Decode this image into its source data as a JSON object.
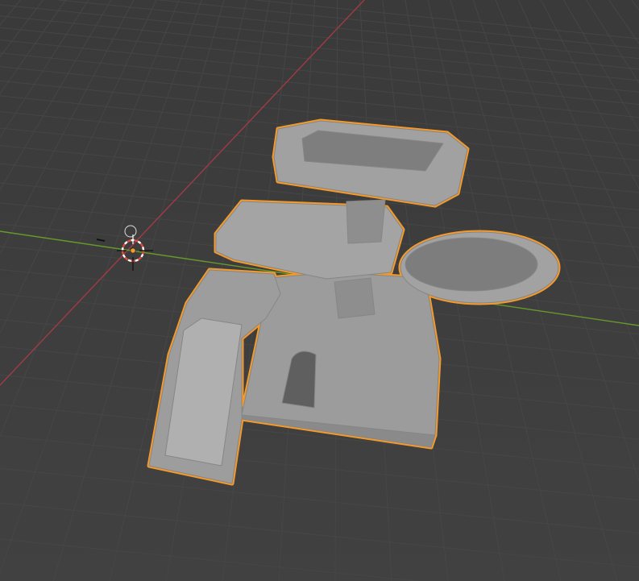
{
  "viewport": {
    "view": "3D Viewport",
    "shading": "solid",
    "background_color": "#3d3d3d",
    "grid_line_color": "#474747",
    "x_axis_color": "#a13a48",
    "y_axis_color": "#66992a"
  },
  "scene_object": {
    "type": "cat-tree-mesh",
    "mesh_color": "#9a9a9a",
    "selected": true,
    "selection_outline_color": "#f39a2b"
  },
  "cursor_3d": {
    "icon": "3d-cursor-icon",
    "colors": [
      "#e04b3a",
      "#ffffff"
    ]
  },
  "object_origin": {
    "icon": "origin-dot-icon",
    "color": "#f39a2b"
  }
}
